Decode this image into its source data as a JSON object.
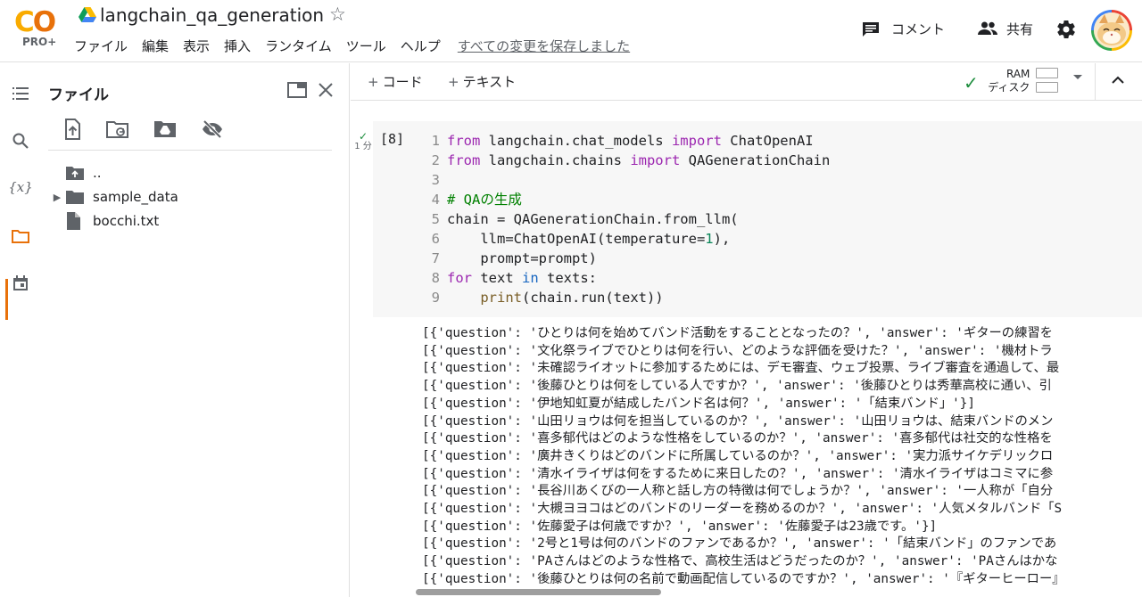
{
  "app": {
    "logo_text": "CO",
    "logo_badge": "PRO+",
    "notebook_title": "langchain_qa_generation",
    "menu": [
      "ファイル",
      "編集",
      "表示",
      "挿入",
      "ランタイム",
      "ツール",
      "ヘルプ"
    ],
    "save_status": "すべての変更を保存しました",
    "comment_label": "コメント",
    "share_label": "共有"
  },
  "sidebar": {
    "title": "ファイル",
    "rail_icons": [
      "toc-icon",
      "search-icon",
      "variables-icon",
      "folder-icon",
      "calendar-icon"
    ],
    "toolbar_icons": [
      "upload-file-icon",
      "refresh-folder-icon",
      "drive-mount-icon",
      "hide-icon"
    ],
    "tree": [
      {
        "label": "..",
        "type": "parent",
        "expandable": false
      },
      {
        "label": "sample_data",
        "type": "folder",
        "expandable": true
      },
      {
        "label": "bocchi.txt",
        "type": "file",
        "expandable": false
      }
    ]
  },
  "notebook_toolbar": {
    "add_code_label": "コード",
    "add_text_label": "テキスト",
    "ram_label": "RAM",
    "disk_label": "ディスク"
  },
  "cell": {
    "exec_count": "[8]",
    "exec_time": "1 分",
    "code_lines": [
      {
        "n": "1",
        "html": "<span class='kw'>from</span> langchain.chat_models <span class='kw'>import</span> ChatOpenAI"
      },
      {
        "n": "2",
        "html": "<span class='kw'>from</span> langchain.chains <span class='kw'>import</span> QAGenerationChain"
      },
      {
        "n": "3",
        "html": ""
      },
      {
        "n": "4",
        "html": "<span class='cm'># QAの生成</span>"
      },
      {
        "n": "5",
        "html": "chain = QAGenerationChain.from_llm("
      },
      {
        "n": "6",
        "html": "    llm=ChatOpenAI(temperature=<span class='num'>1</span>),"
      },
      {
        "n": "7",
        "html": "    prompt=prompt)"
      },
      {
        "n": "8",
        "html": "<span class='kw'>for</span> text <span class='kw2'>in</span> texts:"
      },
      {
        "n": "9",
        "html": "    <span class='fn'>print</span>(chain.run(text))"
      }
    ],
    "output_lines": [
      "[{'question': 'ひとりは何を始めてバンド活動をすることとなったの？', 'answer': 'ギターの練習を",
      "[{'question': '文化祭ライブでひとりは何を行い、どのような評価を受けた？', 'answer': '機材トラ",
      "[{'question': '未確認ライオットに参加するためには、デモ審査、ウェブ投票、ライブ審査を通過して、最",
      "[{'question': '後藤ひとりは何をしている人ですか？', 'answer': '後藤ひとりは秀華高校に通い、引",
      "[{'question': '伊地知虹夏が結成したバンド名は何？', 'answer': '「結束バンド」'}]",
      "[{'question': '山田リョウは何を担当しているのか？', 'answer': '山田リョウは、結束バンドのメン",
      "[{'question': '喜多郁代はどのような性格をしているのか？', 'answer': '喜多郁代は社交的な性格を",
      "[{'question': '廣井きくりはどのバンドに所属しているのか？', 'answer': '実力派サイケデリックロ",
      "[{'question': '清水イライザは何をするために来日したの？', 'answer': '清水イライザはコミマに参",
      "[{'question': '長谷川あくびの一人称と話し方の特徴は何でしょうか？', 'answer': '一人称が「自分",
      "[{'question': '大槻ヨヨコはどのバンドのリーダーを務めるのか？', 'answer': '人気メタルバンド「S",
      "[{'question': '佐藤愛子は何歳ですか？', 'answer': '佐藤愛子は23歳です。'}]",
      "[{'question': '2号と1号は何のバンドのファンであるか？', 'answer': '「結束バンド」のファンであ",
      "[{'question': 'PAさんはどのような性格で、高校生活はどうだったのか？', 'answer': 'PAさんはかな",
      "[{'question': '後藤ひとりは何の名前で動画配信しているのですか？', 'answer': '『ギターヒーロー』"
    ]
  },
  "colors": {
    "accent_orange": "#e8710a",
    "logo_yellow": "#f9ab00",
    "ok_green": "#1e8e3e",
    "keyword_purple": "#9c27b0",
    "comment_green": "#008000"
  }
}
